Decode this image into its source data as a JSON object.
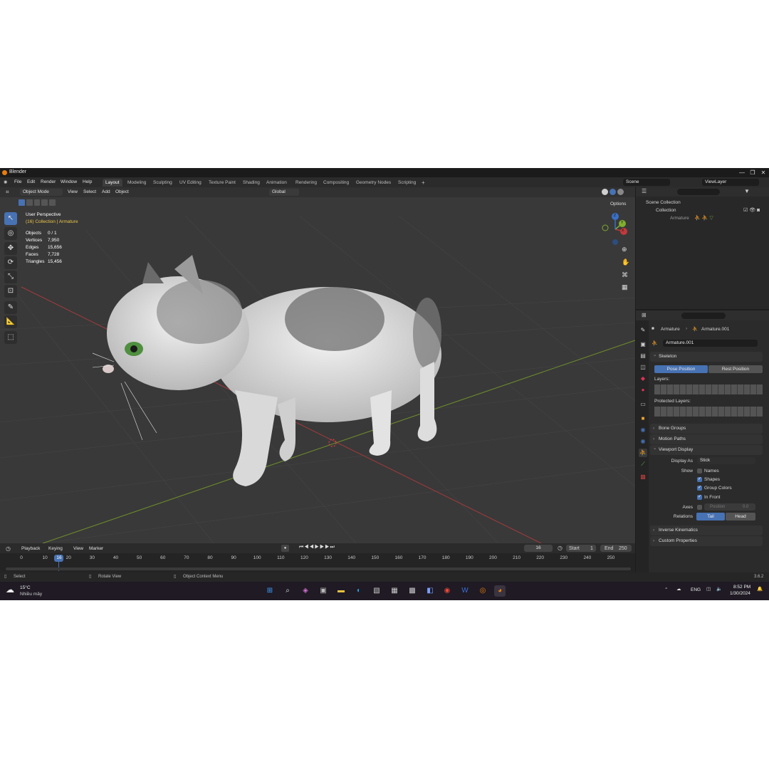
{
  "window": {
    "title": "Blender",
    "minimize": "—",
    "maximize": "❐",
    "close": "✕"
  },
  "menu": [
    "File",
    "Edit",
    "Render",
    "Window",
    "Help"
  ],
  "workspaces": [
    "Layout",
    "Modeling",
    "Sculpting",
    "UV Editing",
    "Texture Paint",
    "Shading",
    "Animation",
    "Rendering",
    "Compositing",
    "Geometry Nodes",
    "Scripting"
  ],
  "workspace_add": "+",
  "scene": {
    "name": "Scene",
    "view_layer": "ViewLayer"
  },
  "viewport": {
    "mode": "Object Mode",
    "menus": [
      "View",
      "Select",
      "Add",
      "Object"
    ],
    "transform_orientation": "Global",
    "options": "Options",
    "overlay_title": "User Perspective",
    "overlay_subtitle": "(16) Collection | Armature",
    "stats": [
      {
        "label": "Objects",
        "value": "0 / 1"
      },
      {
        "label": "Vertices",
        "value": "7,950"
      },
      {
        "label": "Edges",
        "value": "15,656"
      },
      {
        "label": "Faces",
        "value": "7,728"
      },
      {
        "label": "Triangles",
        "value": "15,456"
      }
    ],
    "gizmo": {
      "x": "X",
      "y": "Y",
      "z": "Z"
    }
  },
  "timeline": {
    "menus": [
      "Playback",
      "Keying",
      "View",
      "Marker"
    ],
    "current_frame": "16",
    "start_label": "Start",
    "start": "1",
    "end_label": "End",
    "end": "250",
    "ticks": [
      "0",
      "10",
      "16",
      "20",
      "30",
      "40",
      "50",
      "60",
      "70",
      "80",
      "90",
      "100",
      "110",
      "120",
      "130",
      "140",
      "150",
      "160",
      "170",
      "180",
      "190",
      "200",
      "210",
      "220",
      "230",
      "240",
      "250"
    ]
  },
  "outliner": {
    "root": "Scene Collection",
    "collection": "Collection",
    "object": "Armature"
  },
  "properties": {
    "breadcrumb_object": "Armature",
    "breadcrumb_data": "Armature.001",
    "data_name": "Armature.001",
    "skeleton": "Skeleton",
    "pose_position": "Pose Position",
    "rest_position": "Rest Position",
    "layers": "Layers:",
    "protected_layers": "Protected Layers:",
    "bone_groups": "Bone Groups",
    "motion_paths": "Motion Paths",
    "viewport_display": "Viewport Display",
    "display_as_label": "Display As",
    "display_as": "Stick",
    "show_label": "Show",
    "names": "Names",
    "shapes": "Shapes",
    "group_colors": "Group Colors",
    "in_front": "In Front",
    "axes_label": "Axes",
    "position_label": "Position",
    "position_value": "0.0",
    "relations_label": "Relations",
    "tail": "Tail",
    "head": "Head",
    "inverse_kinematics": "Inverse Kinematics",
    "custom_properties": "Custom Properties"
  },
  "status": {
    "select": "Select",
    "rotate": "Rotate View",
    "context": "Object Context Menu",
    "version": "3.6.2"
  },
  "taskbar": {
    "temperature": "15°C",
    "weather": "Nhiều mây",
    "lang": "ENG",
    "time": "8:52 PM",
    "date": "1/30/2024"
  },
  "colors": {
    "accent": "#4772b3",
    "x_axis": "#c0393c",
    "y_axis": "#7fae2e",
    "z_axis": "#3a6fc4",
    "blender_orange": "#e87d0d"
  }
}
